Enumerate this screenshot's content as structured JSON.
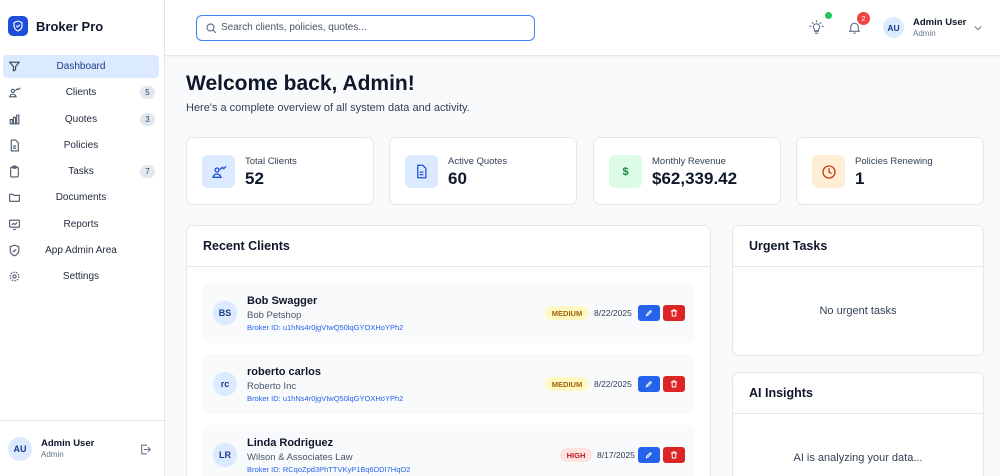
{
  "app": {
    "name": "Broker Pro"
  },
  "sidebar": {
    "items": [
      {
        "label": "Dashboard",
        "icon": "filter-icon",
        "active": true
      },
      {
        "label": "Clients",
        "icon": "users-chart-icon",
        "badge": "5"
      },
      {
        "label": "Quotes",
        "icon": "bar-chart-icon",
        "badge": "3"
      },
      {
        "label": "Policies",
        "icon": "document-icon"
      },
      {
        "label": "Tasks",
        "icon": "clipboard-icon",
        "badge": "7"
      },
      {
        "label": "Documents",
        "icon": "folder-icon"
      },
      {
        "label": "Reports",
        "icon": "report-icon"
      },
      {
        "label": "App Admin Area",
        "icon": "shield-icon"
      },
      {
        "label": "Settings",
        "icon": "gear-icon"
      }
    ],
    "user": {
      "initials": "AU",
      "name": "Admin User",
      "role": "Admin"
    }
  },
  "header": {
    "search_placeholder": "Search clients, policies, quotes...",
    "notifications_count": "2",
    "user": {
      "initials": "AU",
      "name": "Admin User",
      "role": "Admin"
    }
  },
  "main": {
    "title": "Welcome back, Admin!",
    "subtitle": "Here's a complete overview of all system data and activity."
  },
  "stats": [
    {
      "label": "Total Clients",
      "value": "52",
      "icon": "users-chart-icon",
      "color": "#dbeafe"
    },
    {
      "label": "Active Quotes",
      "value": "60",
      "icon": "document-icon",
      "color": "#dbeafe"
    },
    {
      "label": "Monthly Revenue",
      "value": "$62,339.42",
      "icon": "dollar-icon",
      "color": "#dcfce7"
    },
    {
      "label": "Policies Renewing",
      "value": "1",
      "icon": "clock-icon",
      "color": "#ffedd5"
    }
  ],
  "recent_clients": {
    "title": "Recent Clients",
    "rows": [
      {
        "initials": "BS",
        "name": "Bob Swagger",
        "company": "Bob Petshop",
        "broker_id": "Broker ID: u1hNs4r0jgVIwQ50lqGYOXHoYPh2",
        "priority": "MEDIUM",
        "date": "8/22/2025"
      },
      {
        "initials": "rc",
        "name": "roberto carlos",
        "company": "Roberto Inc",
        "broker_id": "Broker ID: u1hNs4r0jgVIwQ50lqGYOXHoYPh2",
        "priority": "MEDIUM",
        "date": "8/22/2025"
      },
      {
        "initials": "LR",
        "name": "Linda Rodriguez",
        "company": "Wilson & Associates Law",
        "broker_id": "Broker ID: RCqoZpd3PhTTVKyP1Bq6DDI7HqO2",
        "priority": "HIGH",
        "date": "8/17/2025"
      }
    ]
  },
  "urgent_tasks": {
    "title": "Urgent Tasks",
    "empty": "No urgent tasks"
  },
  "ai_insights": {
    "title": "AI Insights",
    "status": "AI is analyzing your data..."
  }
}
